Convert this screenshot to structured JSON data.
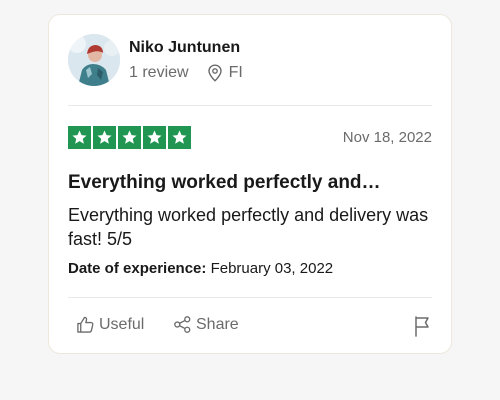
{
  "reviewer": {
    "name": "Niko Juntunen",
    "review_count": "1 review",
    "country": "FI"
  },
  "review": {
    "rating": 5,
    "rating_max": 5,
    "star_color": "#219653",
    "date": "Nov 18, 2022",
    "title": "Everything worked perfectly and…",
    "body": "Everything worked perfectly and delivery was fast! 5/5",
    "experience_label": "Date of experience:",
    "experience_date": "February 03, 2022"
  },
  "actions": {
    "useful_label": "Useful",
    "share_label": "Share"
  },
  "icons": {
    "location": "map-pin-icon",
    "useful": "thumbs-up-icon",
    "share": "share-icon",
    "report": "flag-icon"
  }
}
